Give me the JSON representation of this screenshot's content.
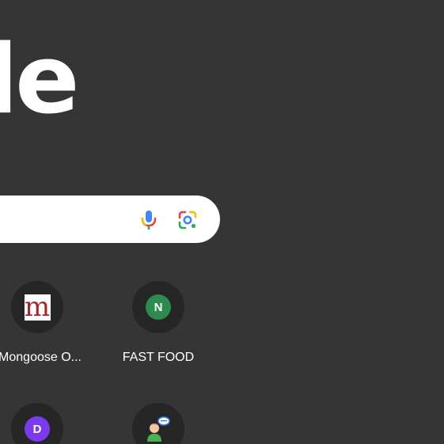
{
  "logo": {
    "visible_text": "le"
  },
  "search": {
    "mic_icon": "microphone-icon",
    "lens_icon": "google-lens-icon"
  },
  "shortcuts": [
    {
      "label": "Mongoose O...",
      "favicon": "m",
      "favicon_color": "#a0262c"
    },
    {
      "label": "FAST FOOD",
      "favicon": "N",
      "favicon_color": "#2e8b4e"
    },
    {
      "label": "",
      "favicon": "D",
      "favicon_color": "#7c3aed"
    },
    {
      "label": "",
      "favicon": "person-chat-icon"
    }
  ],
  "colors": {
    "background": "#353535",
    "tile_circle": "#262626",
    "search_box": "#ffffff"
  }
}
